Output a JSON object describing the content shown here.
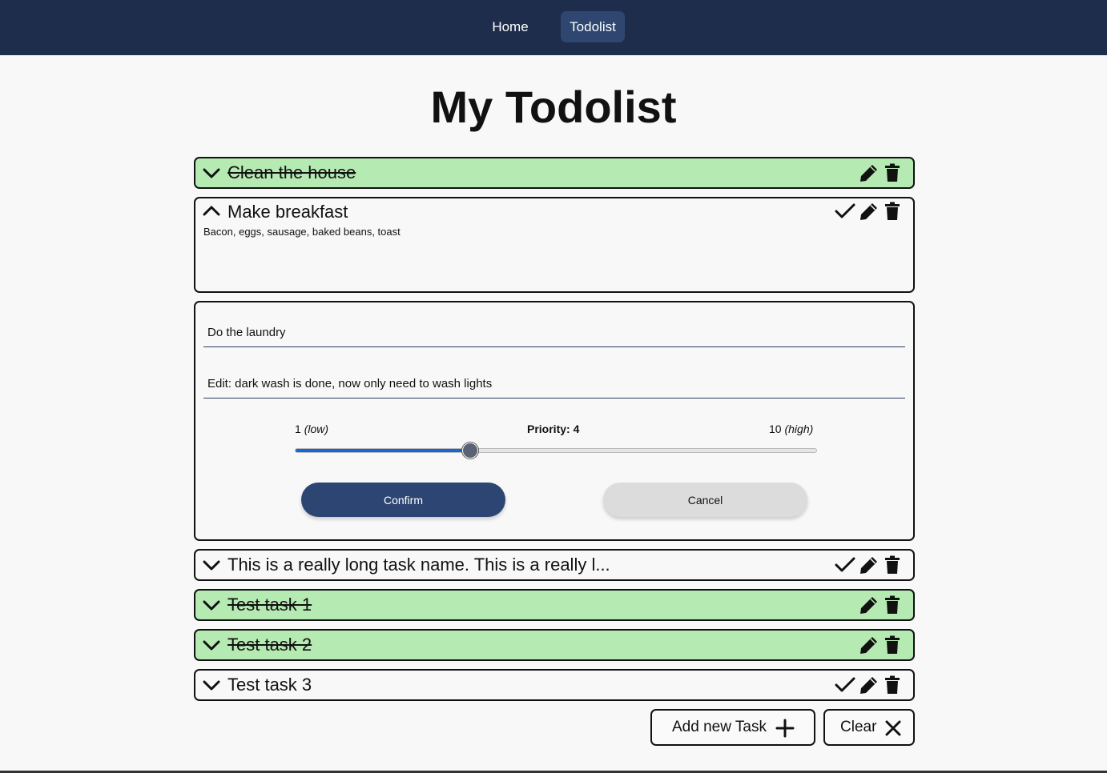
{
  "nav": {
    "items": [
      {
        "label": "Home"
      },
      {
        "label": "Todolist"
      }
    ],
    "active": "Todolist"
  },
  "page": {
    "title": "My Todolist"
  },
  "tasks": [
    {
      "name": "Clean the house",
      "completed": true,
      "expanded": false
    },
    {
      "name": "Make breakfast",
      "completed": false,
      "expanded": true,
      "description": "Bacon, eggs, sausage, baked beans, toast"
    },
    {
      "name": "This is a really long task name. This is a really l...",
      "completed": false,
      "expanded": false
    },
    {
      "name": "Test task 1",
      "completed": true,
      "expanded": false
    },
    {
      "name": "Test task 2",
      "completed": true,
      "expanded": false
    },
    {
      "name": "Test task 3",
      "completed": false,
      "expanded": false
    }
  ],
  "editor": {
    "name_value": "Do the laundry",
    "description_value": "Edit: dark wash is done, now only need to wash lights",
    "priority_low": "1",
    "priority_low_hint": "(low)",
    "priority_high": "10",
    "priority_high_hint": "(high)",
    "priority_label": "Priority: 4",
    "priority_min": 1,
    "priority_max": 10,
    "priority_value": 4,
    "confirm_label": "Confirm",
    "cancel_label": "Cancel"
  },
  "footer": {
    "add_label": "Add new Task",
    "clear_label": "Clear"
  },
  "colors": {
    "navbar": "#1e2d4c",
    "nav_active": "#2e4670",
    "completed_task": "#b6eab3",
    "confirm_button": "#2c4572",
    "cancel_button": "#dcdcdc",
    "slider_fill": "#1566d8"
  },
  "icons": {
    "collapsed": "chevron-down-icon",
    "expanded": "chevron-up-icon",
    "complete": "check-icon",
    "edit": "pencil-icon",
    "delete": "trash-icon",
    "add": "plus-icon",
    "clear": "x-icon"
  }
}
